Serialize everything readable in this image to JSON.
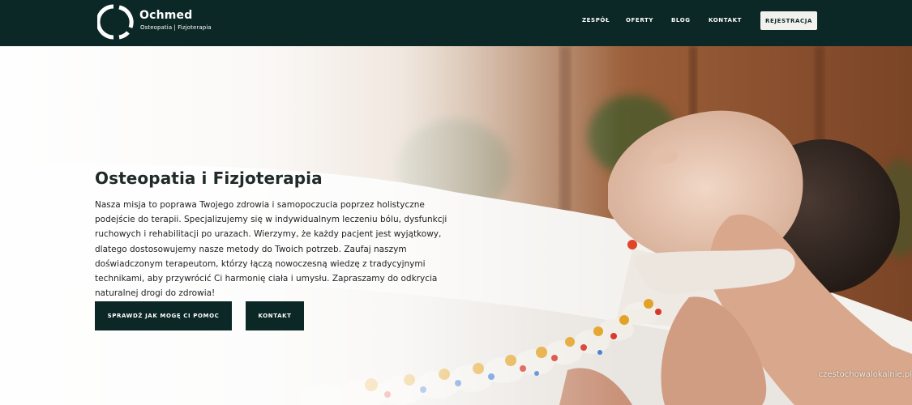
{
  "header": {
    "brand_name": "Ochmed",
    "brand_tagline": "Osteopatia | Fizjoterapia",
    "nav": {
      "team": "ZESPÓŁ",
      "offers": "OFERTY",
      "blog": "BLOG",
      "contact": "KONTAKT"
    },
    "register_label": "REJESTRACJA"
  },
  "hero": {
    "title": "Osteopatia i Fizjoterapia",
    "paragraph": "Nasza misja to poprawa Twojego zdrowia i samopoczucia poprzez holistyczne podejście do terapii. Specjalizujemy się w indywidualnym leczeniu bólu, dysfunkcji ruchowych i rehabilitacji po urazach. Wierzymy, że każdy pacjent jest wyjątkowy, dlatego dostosowujemy nasze metody do Twoich potrzeb. Zaufaj naszym doświadczonym terapeutom, którzy łączą nowoczesną wiedzę z tradycyjnymi technikami, aby przywrócić Ci harmonię ciała i umysłu. Zapraszamy do odkrycia naturalnej drogi do zdrowia!",
    "primary_cta": "SPRAWDŹ JAK MOGĘ CI POMOC",
    "secondary_cta": "KONTAKT",
    "image": "therapist-with-spine-model-photo"
  },
  "watermark": "czestochowalokalnie.pl",
  "colors": {
    "header_bg": "#0c2826",
    "button_bg": "#0c2826",
    "register_bg": "#f3f1ee"
  }
}
